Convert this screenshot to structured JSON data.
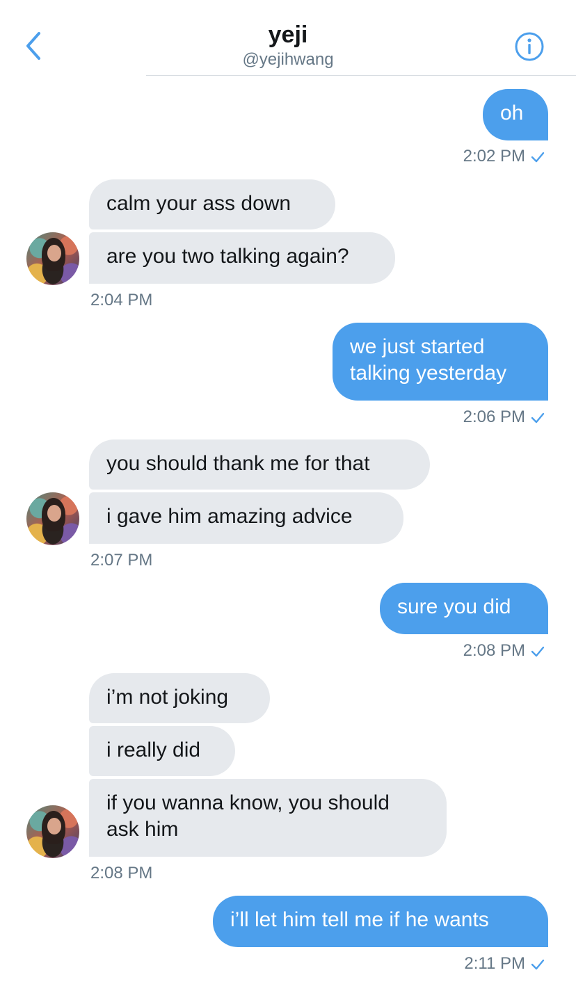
{
  "header": {
    "title": "yeji",
    "handle": "@yejihwang",
    "back_icon": "chevron-left-icon",
    "info_icon": "info-icon",
    "accent": "#4c9fec"
  },
  "colors": {
    "outgoing_bubble": "#4c9fec",
    "incoming_bubble": "#e6e9ed",
    "timestamp": "#657786"
  },
  "messages": {
    "m1": "oh",
    "t1": "2:02 PM",
    "m2": "calm your ass down",
    "m3": "are you two talking again?",
    "t2": "2:04 PM",
    "m4a": "we just started",
    "m4b": "talking yesterday",
    "t3": "2:06 PM",
    "m5": "you should thank me for that",
    "m6": "i gave him amazing advice",
    "t4": "2:07 PM",
    "m7": "sure you did",
    "t5": "2:08 PM",
    "m8": "i’m not joking",
    "m9": "i really did",
    "m10a": "if you wanna know, you should",
    "m10b": "ask him",
    "t6": "2:08 PM",
    "m11": "i’ll let him tell me if he wants",
    "t7": "2:11 PM"
  }
}
